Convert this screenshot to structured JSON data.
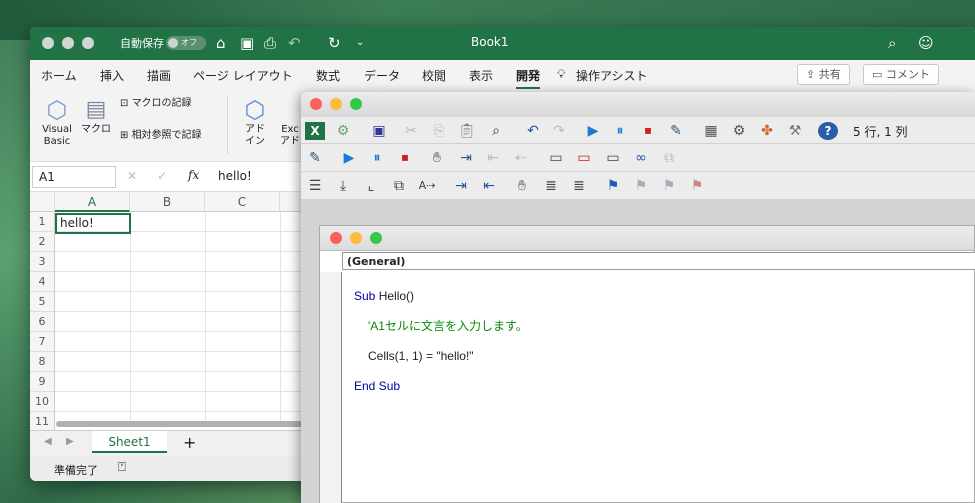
{
  "excel": {
    "autosave_label": "自動保存",
    "autosave_state": "オフ",
    "title": "Book1",
    "menu": [
      "ホーム",
      "挿入",
      "描画",
      "ページ レイアウト",
      "数式",
      "データ",
      "校閲",
      "表示",
      "開発",
      "操作アシスト"
    ],
    "share": "共有",
    "comment": "コメント",
    "ribbon": {
      "vb": "Visual\nBasic",
      "macro": "マクロ",
      "record": "マクロの記録",
      "relative": "相対参照で記録",
      "addin": "アド\nイン",
      "excel_addin": "Exc\nアド"
    },
    "namebox": "A1",
    "fx": "fx",
    "formula": "hello!",
    "columns": [
      "A",
      "B",
      "C"
    ],
    "rows": [
      "1",
      "2",
      "3",
      "4",
      "5",
      "6",
      "7",
      "8",
      "9",
      "10",
      "11"
    ],
    "cell_a1": "hello!",
    "sheet_tab": "Sheet1",
    "add_sheet": "+",
    "status": "準備完了"
  },
  "vbe": {
    "position": "5 行, 1 列",
    "general": "(General)",
    "code": {
      "l1_kw": "Sub",
      "l1_rest": " Hello()",
      "l2": "'A1セルに文言を入力します。",
      "l3": "Cells(1, 1) = \"hello!\"",
      "l4": "End Sub"
    }
  }
}
